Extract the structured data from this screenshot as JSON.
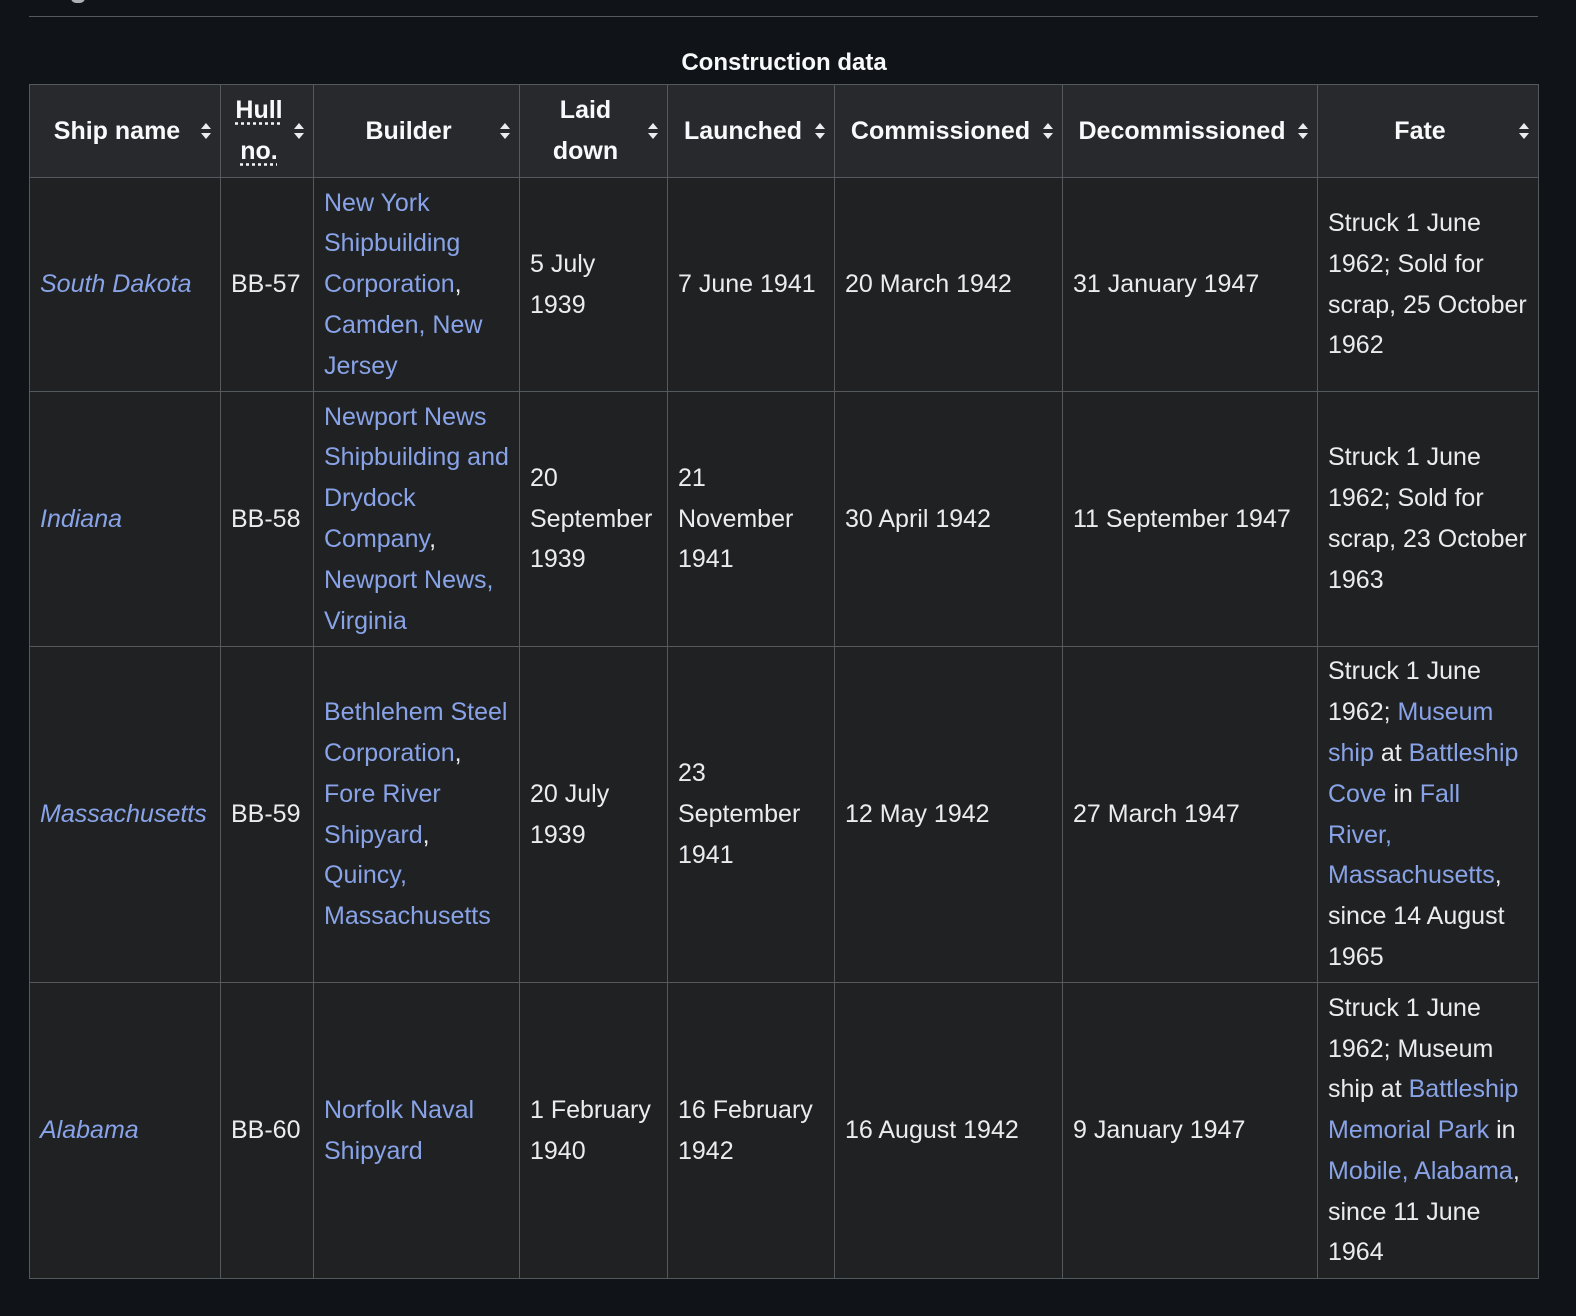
{
  "table": {
    "caption": "Construction data",
    "headers": {
      "ship_name": "Ship name",
      "hull_line1": "Hull",
      "hull_line2": "no.",
      "builder": "Builder",
      "laid_down_line1": "Laid",
      "laid_down_line2": "down",
      "launched": "Launched",
      "commissioned": "Commissioned",
      "decommissioned": "Decommissioned",
      "fate": "Fate"
    },
    "rows": [
      {
        "ship": "South Dakota",
        "hull": "BB-57",
        "builder_link1": "New York Shipbuilding Corporation",
        "builder_sep1": ", ",
        "builder_link2": "Camden, New Jersey",
        "laid_down": "5 July 1939",
        "launched": "7 June 1941",
        "commissioned": "20 March 1942",
        "decommissioned": "31 January 1947",
        "fate": "Struck 1 June 1962; Sold for scrap, 25 October 1962"
      },
      {
        "ship": "Indiana",
        "hull": "BB-58",
        "builder_link1": "Newport News Shipbuilding and Drydock Company",
        "builder_sep1": ", ",
        "builder_link2": "Newport News, Virginia",
        "laid_down": "20 September 1939",
        "launched": "21 November 1941",
        "commissioned": "30 April 1942",
        "decommissioned": "11 September 1947",
        "fate": "Struck 1 June 1962; Sold for scrap, 23 October 1963"
      },
      {
        "ship": "Massachusetts",
        "hull": "BB-59",
        "builder_link1": "Bethlehem Steel Corporation",
        "builder_sep1": ", ",
        "builder_link2": "Fore River Shipyard",
        "builder_sep2": ", ",
        "builder_link3": "Quincy, Massachusetts",
        "laid_down": "20 July 1939",
        "launched": "23 September 1941",
        "commissioned": "12 May 1942",
        "decommissioned": "27 March 1947",
        "fate_t1": "Struck 1 June 1962; ",
        "fate_l1": "Museum ship",
        "fate_t2": " at ",
        "fate_l2": "Battleship Cove",
        "fate_t3": " in ",
        "fate_l3": "Fall River, Massachusetts",
        "fate_t4": ", since 14 August 1965"
      },
      {
        "ship": "Alabama",
        "hull": "BB-60",
        "builder_link1": "Norfolk Naval Shipyard",
        "laid_down": "1 February 1940",
        "launched": "16 February 1942",
        "commissioned": "16 August 1942",
        "decommissioned": "9 January 1947",
        "fate_t1": "Struck 1 June 1962; Museum ship at ",
        "fate_l1": "Battleship Memorial Park",
        "fate_t2": " in ",
        "fate_l2": "Mobile, Alabama",
        "fate_t3": ", since 11 June 1964"
      }
    ]
  }
}
